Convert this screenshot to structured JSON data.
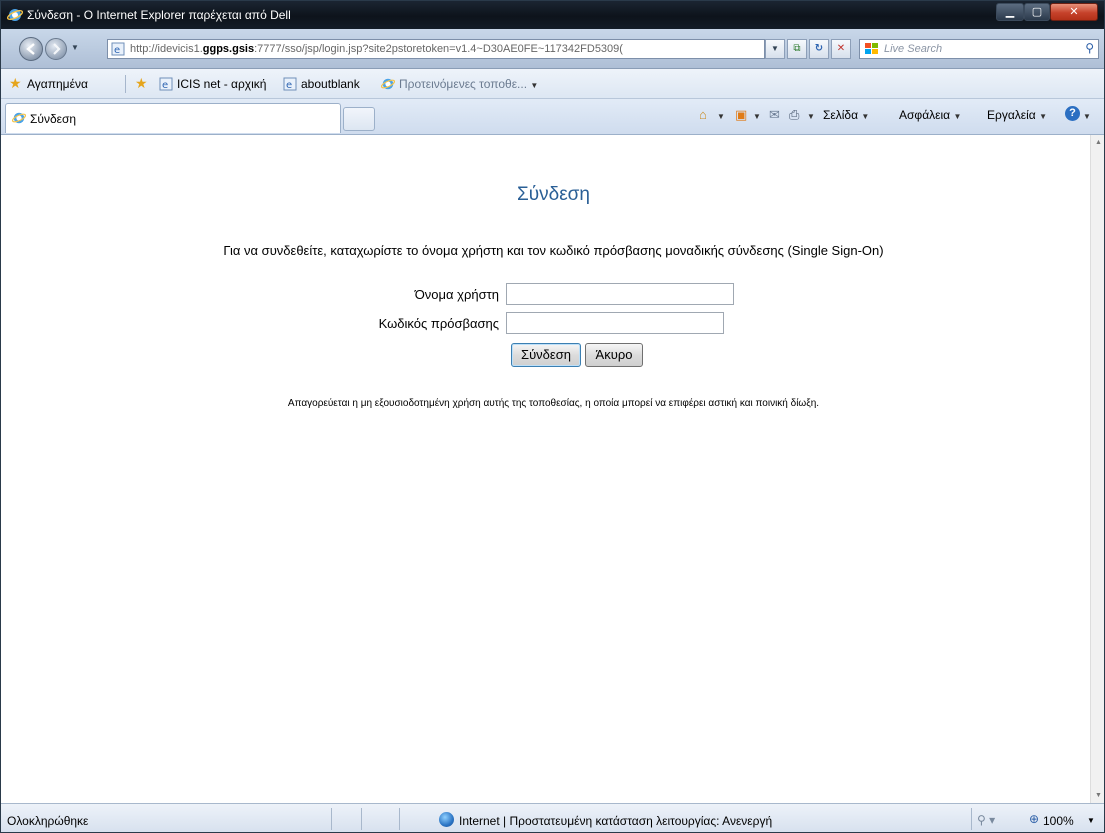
{
  "window": {
    "title": "Σύνδεση - O Internet Explorer παρέχεται από Dell",
    "icon": "ie-icon"
  },
  "address_bar": {
    "url_prefix": "http://idevicis1.",
    "url_host": "ggps.gsis",
    "url_rest": ":7777/sso/jsp/login.jsp?site2pstoretoken=v1.4~D30AE0FE~117342FD5309("
  },
  "search": {
    "placeholder": "Live Search"
  },
  "favorites_bar": {
    "favorites_label": "Αγαπημένα",
    "items": [
      {
        "label": "ICIS net - αρχική"
      },
      {
        "label": "aboutblank"
      },
      {
        "label": "Προτεινόμενες τοποθε..."
      }
    ]
  },
  "tabs": [
    {
      "label": "Σύνδεση"
    }
  ],
  "command_bar": {
    "page": "Σελίδα",
    "safety": "Ασφάλεια",
    "tools": "Εργαλεία"
  },
  "login": {
    "heading": "Σύνδεση",
    "instruction": "Για να συνδεθείτε, καταχωρίστε το όνομα χρήστη και τον κωδικό πρόσβασης μοναδικής σύνδεσης (Single Sign-On)",
    "username_label": "Όνομα χρήστη",
    "username_value": "",
    "password_label": "Κωδικός πρόσβασης",
    "password_value": "",
    "submit_label": "Σύνδεση",
    "cancel_label": "Άκυρο",
    "disclaimer": "Απαγορεύεται η μη εξουσιοδοτημένη χρήση αυτής της τοποθεσίας, η οποία μπορεί να επιφέρει αστική και ποινική δίωξη."
  },
  "status_bar": {
    "status": "Ολοκληρώθηκε",
    "zone": "Internet | Προστατευμένη κατάσταση λειτουργίας: Ανενεργή",
    "zoom": "100%"
  },
  "colors": {
    "heading": "#2a5f96",
    "titlebar": "#131c27"
  }
}
